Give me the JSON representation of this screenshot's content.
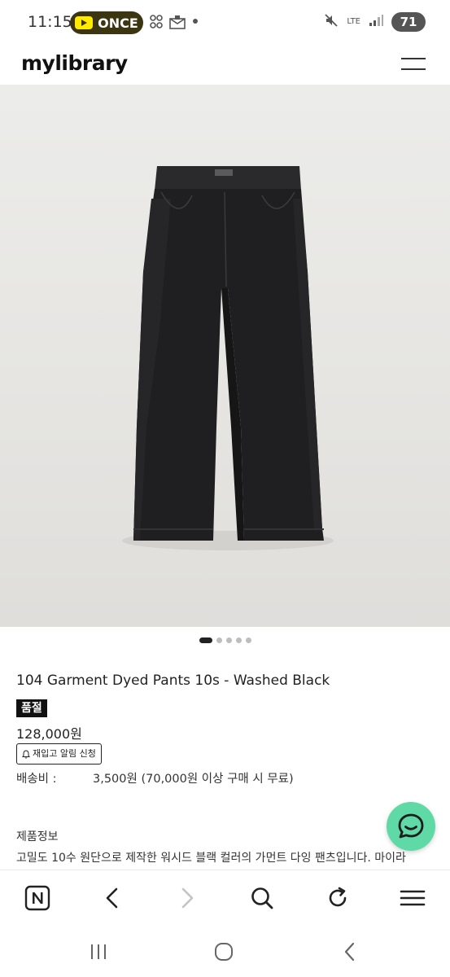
{
  "status_bar": {
    "time": "11:15",
    "pill_label": "ONCE",
    "network": "LTE",
    "battery": "71"
  },
  "header": {
    "logo": "mylibrary"
  },
  "gallery": {
    "image_count": 5,
    "active_index": 0
  },
  "product": {
    "title": "104 Garment Dyed Pants 10s - Washed Black",
    "soldout_badge": "품절",
    "price": "128,000원",
    "restock_button": "재입고 알림 신청",
    "shipping_label": "배송비 :",
    "shipping_value": "3,500원 (70,000원 이상 구매 시 무료)",
    "info_heading": "제품정보",
    "info_description": "고밀도 10수 원단으로 제작한 워시드 블랙 컬러의 가먼트 다잉 팬츠입니다. 마이라"
  },
  "colors": {
    "chat_button": "#5fd9a5",
    "soldout_bg": "#111111",
    "pill_bg": "#3b3512"
  }
}
